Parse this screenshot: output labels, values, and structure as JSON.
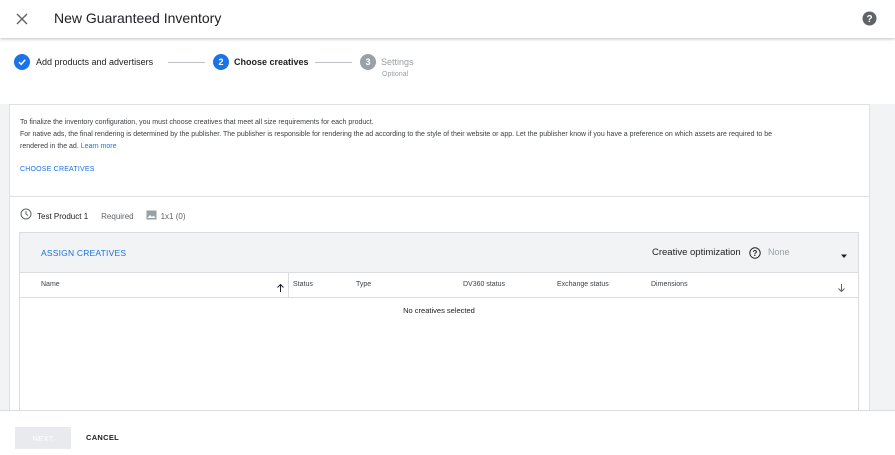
{
  "header": {
    "title": "New Guaranteed Inventory",
    "close_icon": "close-icon",
    "help_icon": "help-icon"
  },
  "stepper": {
    "steps": [
      {
        "number": "1",
        "label": "Add products and advertisers",
        "state": "completed",
        "sub": ""
      },
      {
        "number": "2",
        "label": "Choose creatives",
        "state": "active",
        "sub": ""
      },
      {
        "number": "3",
        "label": "Settings",
        "state": "inactive",
        "sub": "Optional"
      }
    ]
  },
  "info": {
    "line1": "To finalize the inventory configuration, you must choose creatives that meet all size requirements for each product.",
    "line2": "For native ads, the final rendering is determined by the publisher. The publisher is responsible for rendering the ad according to the style of their website or app. Let the publisher know if you have a preference on which assets are required to be",
    "line3": "rendered in the ad.",
    "learn_more": "Learn more",
    "choose_creatives": "CHOOSE CREATIVES"
  },
  "product": {
    "name": "Test Product 1",
    "status": "Required",
    "size": "1x1 (0)"
  },
  "creatives": {
    "assign_label": "ASSIGN CREATIVES",
    "optimization_label": "Creative optimization",
    "optimization_value": "None",
    "columns": [
      "Name",
      "Status",
      "Type",
      "DV360 status",
      "Exchange status",
      "Dimensions"
    ],
    "empty_message": "No creatives selected"
  },
  "footer": {
    "next_label": "NEXT",
    "cancel_label": "CANCEL"
  },
  "colors": {
    "accent": "#1a73e8",
    "inactive": "#9aa0a6"
  }
}
